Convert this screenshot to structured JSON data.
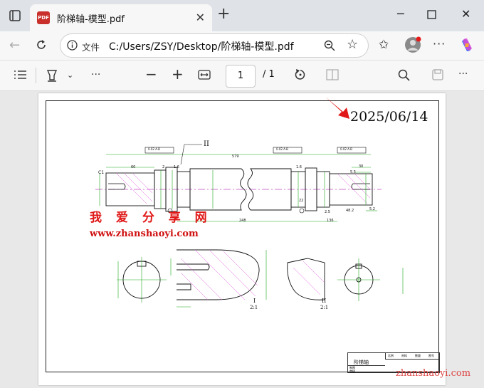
{
  "browser": {
    "tab_title": "阶梯轴-模型.pdf",
    "pdf_badge": "PDF",
    "address_label": "文件",
    "url": "C:/Users/ZSY/Desktop/阶梯轴-模型.pdf"
  },
  "toolbar": {
    "page_current": "1",
    "page_total": "/ 1"
  },
  "drawing": {
    "date_stamp": "2025/06/14",
    "section_label": "II",
    "dim_total": "579",
    "dim_60": "60",
    "dim_2": "2",
    "dim_1_6_left": "1.6",
    "dim_1_6_right": "1.6",
    "dim_30": "30",
    "dim_5_5": "5.5",
    "dim_248": "248",
    "dim_136": "136",
    "dim_22": "22",
    "dim_2_5": "2.5",
    "dim_48": "48.2",
    "dim_5_2": "5.2",
    "chamfer": "C1",
    "tol_1": "0.02 A-B",
    "tol_2": "0.02 A-B",
    "tol_3": "0.02 A-B",
    "view_1": "I",
    "view_1_scale": "2:1",
    "view_2": "II",
    "view_2_scale": "2:1",
    "titleblock_name": "阶梯轴",
    "titleblock_headers": [
      "比例",
      "材料",
      "数量",
      "图号"
    ],
    "titleblock_rows": [
      "制图",
      "审核"
    ]
  },
  "watermark": {
    "site_cn": "我 爱 分 享 网",
    "site_url": "www.zhanshaoyi.com",
    "corner_url": "zhanshaoyi.com"
  }
}
